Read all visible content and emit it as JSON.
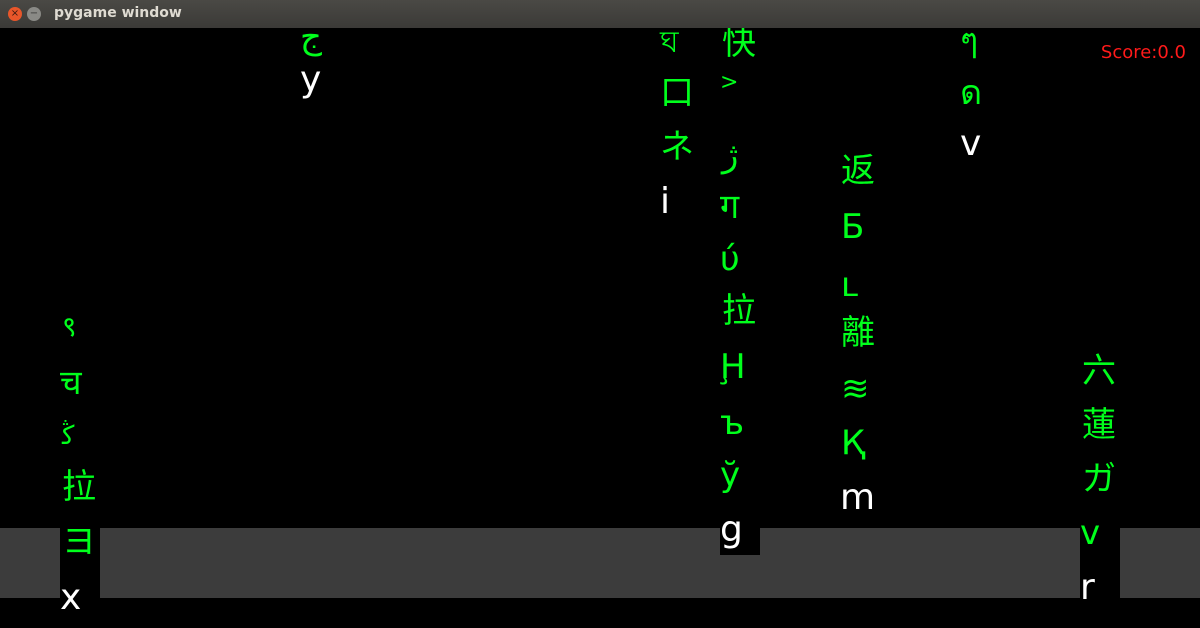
{
  "window": {
    "title": "pygame window",
    "close_glyph": "×",
    "minimize_glyph": "−"
  },
  "hud": {
    "score_text": "Score:0.0"
  },
  "colors": {
    "trail": "#00ff1c",
    "head": "#ffffff",
    "score": "#ff1a1a",
    "ground": "#3c3c3c",
    "background": "#000000"
  },
  "columns": [
    {
      "name": "col-1",
      "trail": [
        "९",
        "च",
        "ﯕ",
        "拉",
        "ヨ"
      ],
      "head": "x"
    },
    {
      "name": "col-2",
      "trail": [
        "ج"
      ],
      "head": "y"
    },
    {
      "name": "col-3",
      "trail": [
        "ঘ",
        "口",
        "ネ"
      ],
      "head": "i"
    },
    {
      "name": "col-4",
      "trail": [
        "快",
        ">",
        "ژ",
        "ग",
        "ύ",
        "拉",
        "Ḩ",
        "ъ",
        "ў"
      ],
      "head": "g"
    },
    {
      "name": "col-5",
      "trail": [
        "返",
        "Б",
        "ʟ",
        "離",
        "≋",
        "Қ"
      ],
      "head": "m"
    },
    {
      "name": "col-6",
      "trail": [
        "ๆ",
        "ด"
      ],
      "head": "v"
    },
    {
      "name": "col-7",
      "trail": [
        "六",
        "蓮",
        "ガ",
        "v"
      ],
      "head": "r"
    }
  ]
}
